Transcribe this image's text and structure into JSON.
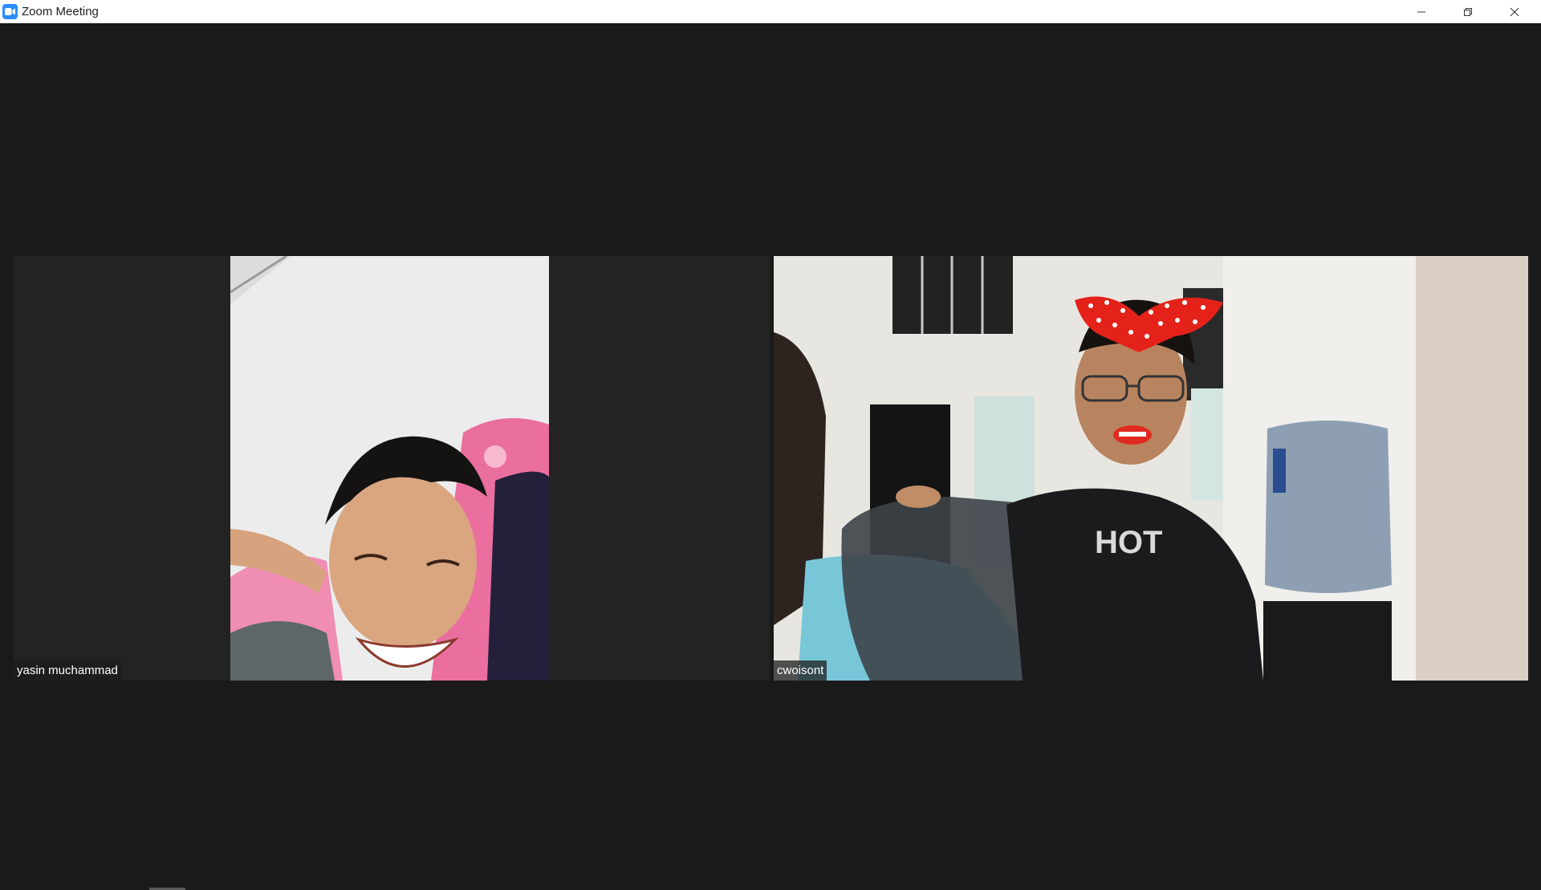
{
  "window": {
    "title": "Zoom Meeting",
    "icon": "zoom-camera-icon",
    "controls": [
      "minimize-icon",
      "restore-icon",
      "close-icon"
    ]
  },
  "participants": [
    {
      "name": "yasin muchammad"
    },
    {
      "name": "cwoisont"
    }
  ],
  "colors": {
    "background": "#1a1a1a",
    "tile_background": "#232323",
    "zoom_blue": "#2d8cff",
    "titlebar": "#ffffff"
  }
}
